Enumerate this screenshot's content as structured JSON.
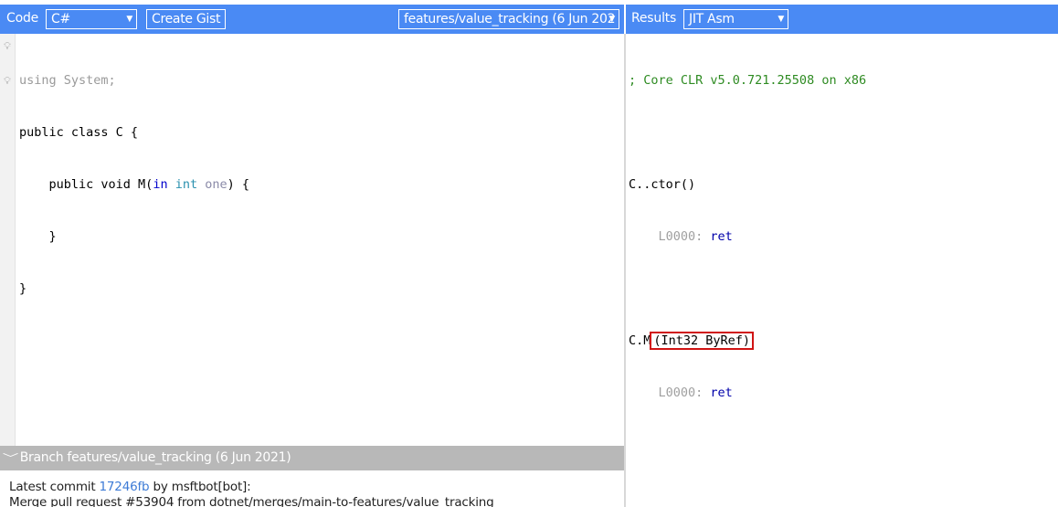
{
  "code_header": {
    "label": "Code",
    "language": "C#",
    "create_gist": "Create Gist",
    "branch_selector": "features/value_tracking (6 Jun 202"
  },
  "results_header": {
    "label": "Results",
    "output_type": "JIT Asm"
  },
  "code": {
    "line1_kw": "using",
    "line1_rest": " System;",
    "line2": "public class C {",
    "line3_a": "    public void M(",
    "line3_in": "in",
    "line3_sp": " ",
    "line3_int": "int",
    "line3_param": " one",
    "line3_end": ") {",
    "line4": "    }",
    "line5": "}"
  },
  "branch": {
    "title": "Branch features/value_tracking (6 Jun 2021)",
    "commit_prefix": "Latest commit ",
    "commit_hash": "17246fb",
    "commit_by": " by msftbot[bot]:",
    "commit_message": "Merge pull request #53904 from dotnet/merges/main-to-features/value_tracking"
  },
  "asm": {
    "header_comment": "; Core CLR v5.0.721.25508 on x86",
    "ctor_name": "C..ctor()",
    "ctor_label": "    L0000: ",
    "ctor_instr": "ret",
    "method_prefix": "C.M",
    "method_sig": "(Int32 ByRef)",
    "method_label": "    L0000: ",
    "method_instr": "ret"
  },
  "colors": {
    "topbar": "#4a8af4",
    "highlight_box": "#d01414",
    "comment": "#2e8b22",
    "branch_bar": "#b8b8b8"
  }
}
